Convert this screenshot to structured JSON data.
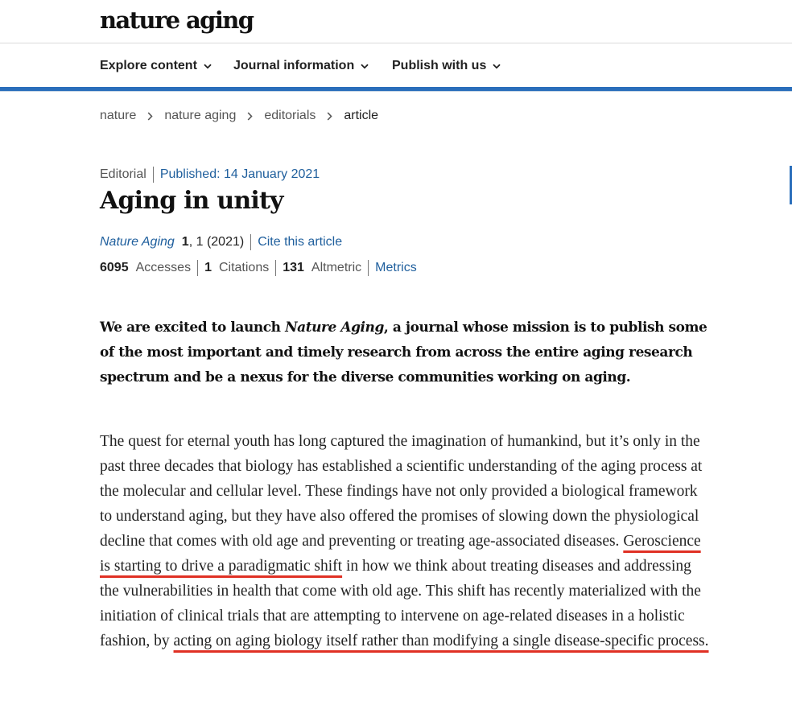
{
  "header": {
    "logo": "nature aging"
  },
  "nav": {
    "items": [
      {
        "label": "Explore content"
      },
      {
        "label": "Journal information"
      },
      {
        "label": "Publish with us"
      }
    ],
    "accent_color": "#2a6ebb"
  },
  "breadcrumb": {
    "items": [
      "nature",
      "nature aging",
      "editorials"
    ],
    "current": "article"
  },
  "article": {
    "type": "Editorial",
    "published": "Published: 14 January 2021",
    "title": "Aging in unity",
    "journal": "Nature Aging",
    "volume": "1",
    "pages": ", 1 (2021)",
    "cite_label": "Cite this article",
    "metrics": {
      "accesses_value": "6095",
      "accesses_label": "Accesses",
      "citations_value": "1",
      "citations_label": "Citations",
      "altmetric_value": "131",
      "altmetric_label": "Altmetric",
      "link_label": "Metrics"
    },
    "standfirst": {
      "before": "We are excited to launch ",
      "journal": "Nature Aging",
      "after": ", a journal whose mission is to publish some of the most important and timely research from across the entire aging research spectrum and be a nexus for the diverse communities working on aging."
    },
    "body": {
      "part1": "The quest for eternal youth has long captured the imagination of humankind, but it’s only in the past three decades that biology has established a scientific understanding of the aging process at the molecular and cellular level. These findings have not only provided a biological framework to understand aging, but they have also offered the promises of slowing down the physiological decline that comes with old age and preventing or treating age-associated diseases. ",
      "highlight1": "Geroscience is starting to drive a paradigmatic shift",
      "part2": " in how we think about treating diseases and addressing the vulnerabilities in health that come with old age. This shift has recently materialized with the initiation of clinical trials that are attempting to intervene on age-related diseases in a holistic fashion, by ",
      "highlight2": "acting on aging biology itself rather than modifying a single disease-specific process.",
      "highlight_color": "#e03024"
    },
    "link_color": "#1f5f9d"
  }
}
